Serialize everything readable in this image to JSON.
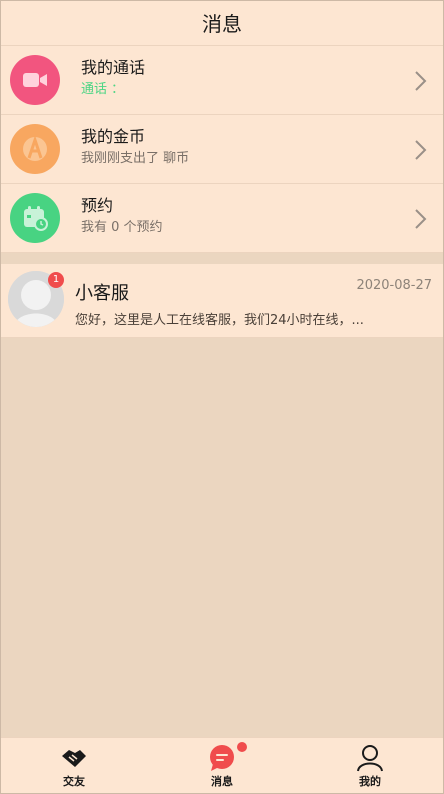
{
  "header": {
    "title": "消息"
  },
  "menu": [
    {
      "title": "我的通话",
      "subtitle": "通话 ：",
      "icon": "video-camera-icon",
      "color": "#f2557f"
    },
    {
      "title": "我的金币",
      "subtitle": "我刚刚支出了  聊币",
      "icon": "coin-icon",
      "color": "#f8a760"
    },
    {
      "title": "预约",
      "subtitle": "我有 0 个预约",
      "icon": "calendar-clock-icon",
      "color": "#48d382"
    }
  ],
  "conversations": [
    {
      "name": "小客服",
      "date": "2020-08-27",
      "preview": "您好，这里是人工在线客服，我们24小时在线，...",
      "unread": "1"
    }
  ],
  "tabbar": {
    "tabs": [
      {
        "label": "交友",
        "icon": "handshake-icon"
      },
      {
        "label": "消息",
        "icon": "chat-bubble-icon",
        "active": true
      },
      {
        "label": "我的",
        "icon": "person-icon"
      }
    ]
  },
  "colors": {
    "accent_red": "#f04c4c",
    "background": "#ebd6c0",
    "surface": "#fde6d2"
  }
}
